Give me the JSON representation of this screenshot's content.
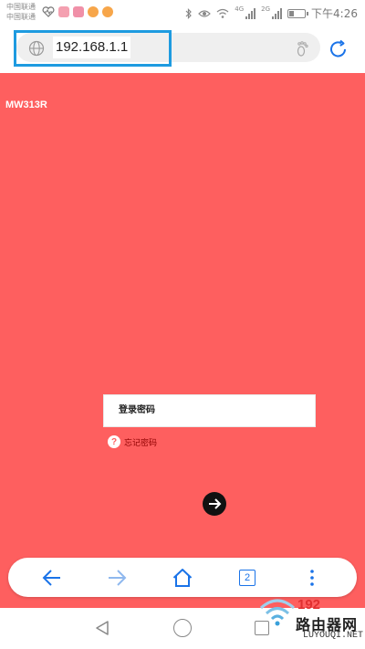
{
  "status_bar": {
    "carrier_1": "中国联通",
    "carrier_2": "中国联通",
    "network_1": "4G",
    "network_2": "2G",
    "time": "下午4:26"
  },
  "browser": {
    "url": "192.168.1.1",
    "highlight_color": "#1e9be0",
    "toolbar": {
      "tab_count": "2"
    }
  },
  "page": {
    "background_color": "#fe5f5f",
    "model": "MW313R",
    "password_placeholder": "登录密码",
    "forgot_icon": "?",
    "forgot_label": "忘记密码"
  },
  "watermark": {
    "number": "192",
    "brand_cn": "路由器网",
    "site": "LUYOUQI.NET"
  },
  "icons": {
    "url_bar": [
      "globe-icon",
      "footprint-icon",
      "refresh-icon"
    ],
    "toolbar": [
      "back-arrow-icon",
      "forward-arrow-icon",
      "home-icon",
      "tabs-icon",
      "more-menu-icon"
    ],
    "login": "arrow-right-icon",
    "nav_bar": [
      "nav-back-icon",
      "nav-home-icon",
      "nav-recent-icon"
    ]
  }
}
